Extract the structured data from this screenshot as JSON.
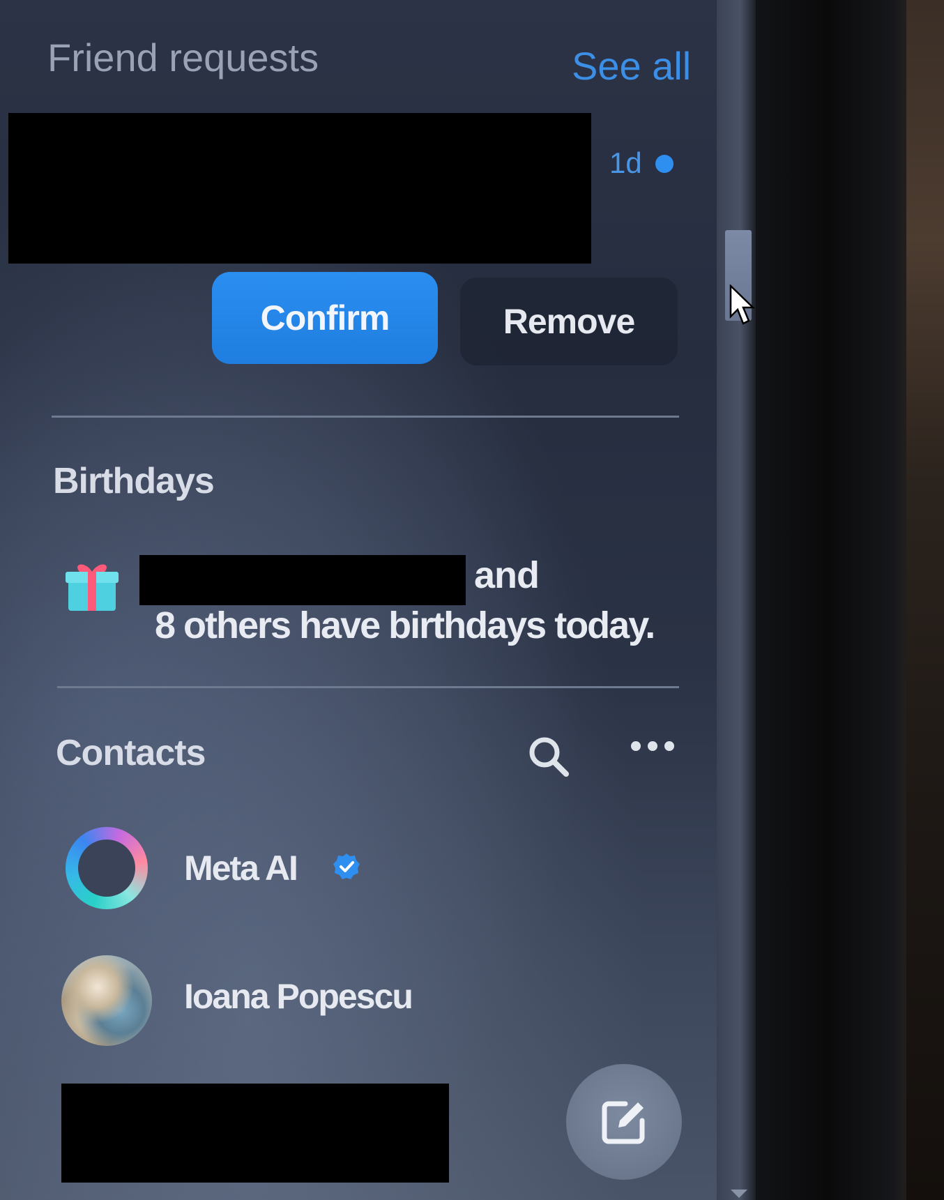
{
  "friend_requests": {
    "title": "Friend requests",
    "see_all_label": "See all",
    "request": {
      "time_ago": "1d",
      "confirm_label": "Confirm",
      "remove_label": "Remove"
    }
  },
  "birthdays": {
    "title": "Birthdays",
    "icon": "gift-icon",
    "text_and": "and",
    "text_others": "8 others have birthdays today."
  },
  "contacts": {
    "title": "Contacts",
    "search_icon": "search-icon",
    "more_icon": "more-options-icon",
    "items": [
      {
        "name": "Meta AI",
        "verified": true,
        "avatar": "meta-ai-ring-icon"
      },
      {
        "name": "Ioana Popescu",
        "verified": false,
        "avatar": "profile-photo"
      }
    ]
  },
  "compose_icon": "compose-icon",
  "colors": {
    "accent": "#2a8ef0",
    "link": "#3c8fe6",
    "panel_bg": "#2a3245",
    "text": "#e6e9ef"
  }
}
